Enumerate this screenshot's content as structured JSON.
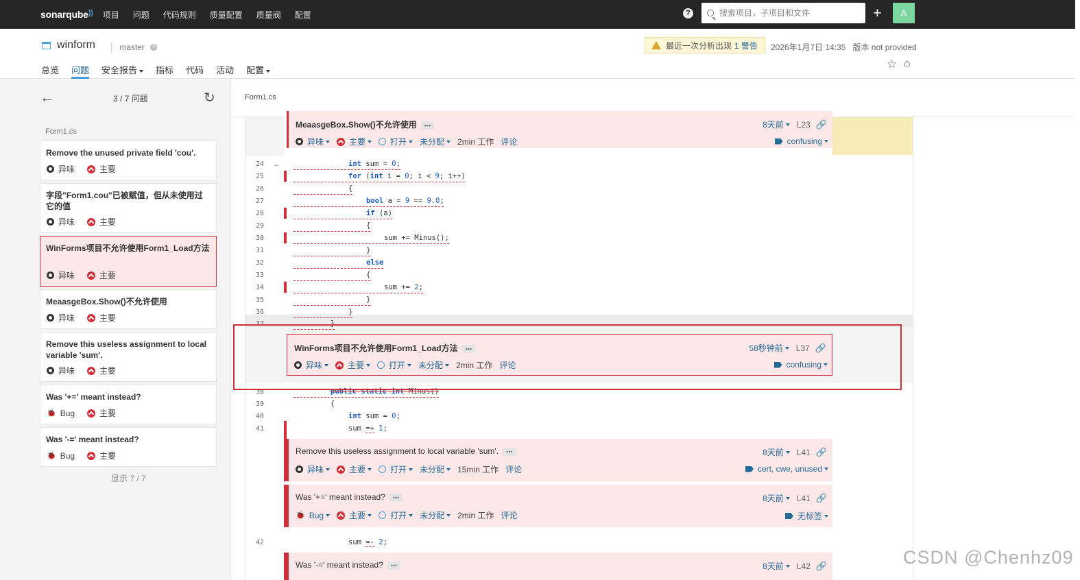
{
  "topnav": {
    "logo": "sonarqube",
    "menu": [
      "项目",
      "问题",
      "代码规则",
      "质量配置",
      "质量阀",
      "配置"
    ],
    "search_placeholder": "搜索项目，子项目和文件",
    "avatar_letter": "A"
  },
  "project": {
    "name": "winform",
    "branch": "master",
    "warning_text": "最近一次分析出现",
    "warning_link": "1 警告",
    "analysis_date": "2026年1月7日 14:35",
    "version": "版本 not provided",
    "tabs": [
      "总览",
      "问题",
      "安全报告",
      "指标",
      "代码",
      "活动",
      "配置"
    ],
    "active_tab": "问题"
  },
  "left": {
    "count": "3 / 7 问题",
    "file": "Form1.cs",
    "issues": [
      {
        "message": "Remove the unused private field 'cou'.",
        "type": "异味",
        "severity": "主要"
      },
      {
        "message": "字段\"Form1.cou\"已被赋值，但从未使用过它的值",
        "type": "异味",
        "severity": "主要"
      },
      {
        "message": "WinForms项目不允许使用Form1_Load方法",
        "type": "异味",
        "severity": "主要"
      },
      {
        "message": "MeaasgeBox.Show()不允许使用",
        "type": "异味",
        "severity": "主要"
      },
      {
        "message": "Remove this useless assignment to local variable 'sum'.",
        "type": "异味",
        "severity": "主要"
      },
      {
        "message": "Was '+=' meant instead?",
        "type": "Bug",
        "severity": "主要"
      },
      {
        "message": "Was '-=' meant instead?",
        "type": "Bug",
        "severity": "主要"
      }
    ],
    "shown": "显示 7 / 7"
  },
  "file_header": {
    "name": "Form1.cs"
  },
  "code_lines": [
    {
      "n": "24",
      "html": "int sum = 0;"
    },
    {
      "n": "25",
      "html": "for (int i = 0; i < 9; i++)"
    },
    {
      "n": "26",
      "html": "{"
    },
    {
      "n": "27",
      "html": "bool a = 9 == 9.0;"
    },
    {
      "n": "28",
      "html": "if (a)"
    },
    {
      "n": "29",
      "html": "{"
    },
    {
      "n": "30",
      "html": "sum += Minus();"
    },
    {
      "n": "31",
      "html": "}"
    },
    {
      "n": "32",
      "html": "else"
    },
    {
      "n": "33",
      "html": "{"
    },
    {
      "n": "34",
      "html": "sum += 2;"
    },
    {
      "n": "35",
      "html": "}"
    },
    {
      "n": "36",
      "html": "}"
    },
    {
      "n": "37",
      "html": "}"
    },
    {
      "n": "38",
      "html": "public static int Minus()"
    },
    {
      "n": "39",
      "html": "{"
    },
    {
      "n": "40",
      "html": "int sum = 0;"
    },
    {
      "n": "41",
      "html": "sum =+ 1;"
    },
    {
      "n": "42",
      "html": "sum =- 2;"
    }
  ],
  "issue_blocks": [
    {
      "title": "MeaasgeBox.Show()不允许使用",
      "age": "8天前",
      "line": "L23",
      "type": "异味",
      "severity": "主要",
      "status": "打开",
      "assignee": "未分配",
      "effort": "2min 工作",
      "comment": "评论",
      "tags": "confusing"
    },
    {
      "title": "WinForms项目不允许使用Form1_Load方法",
      "age": "58秒钟前",
      "line": "L37",
      "type": "异味",
      "severity": "主要",
      "status": "打开",
      "assignee": "未分配",
      "effort": "2min 工作",
      "comment": "评论",
      "tags": "confusing"
    },
    {
      "title": "Remove this useless assignment to local variable 'sum'.",
      "age": "8天前",
      "line": "L41",
      "type": "异味",
      "severity": "主要",
      "status": "打开",
      "assignee": "未分配",
      "effort": "15min 工作",
      "comment": "评论",
      "tags": "cert, cwe, unused"
    },
    {
      "title": "Was '+=' meant instead?",
      "age": "8天前",
      "line": "L41",
      "type": "Bug",
      "severity": "主要",
      "status": "打开",
      "assignee": "未分配",
      "effort": "2min 工作",
      "comment": "评论",
      "tags": "无标签"
    },
    {
      "title": "Was '-=' meant instead?",
      "age": "8天前",
      "line": "L42"
    }
  ],
  "watermark": "CSDN @Chenhz09",
  "colors": {
    "accent": "#4b9fd5",
    "link": "#236a97",
    "major": "#d02f3a",
    "issue_bg": "#fce8e8",
    "topnav": "#262626"
  }
}
